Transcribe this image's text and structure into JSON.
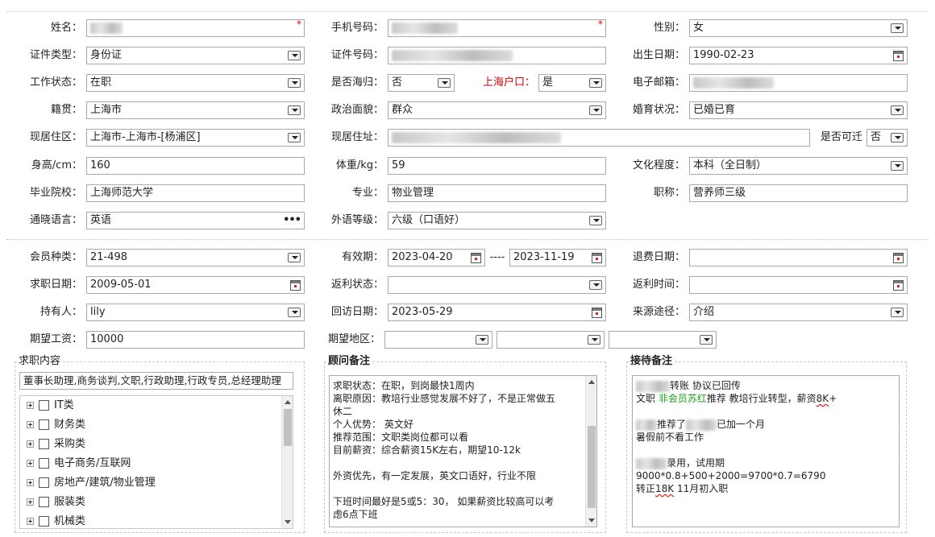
{
  "basic": {
    "name_label": "姓名：",
    "phone_label": "手机号码：",
    "gender_label": "性别：",
    "gender_value": "女",
    "idtype_label": "证件类型：",
    "idtype_value": "身份证",
    "idno_label": "证件号码：",
    "birth_label": "出生日期：",
    "birth_value": "1990-02-23",
    "workstatus_label": "工作状态：",
    "workstatus_value": "在职",
    "returnee_label": "是否海归：",
    "returnee_value": "否",
    "shhukou_label": "上海户口：",
    "shhukou_value": "是",
    "email_label": "电子邮箱：",
    "native_label": "籍贯：",
    "native_value": "上海市",
    "political_label": "政治面貌：",
    "political_value": "群众",
    "marital_label": "婚育状况：",
    "marital_value": "已婚已育",
    "residence_label": "现居住区：",
    "residence_value": "上海市-上海市-[杨浦区]",
    "address_label": "现居住址：",
    "relocate_label": "是否可迁",
    "relocate_value": "否",
    "height_label": "身高/cm：",
    "height_value": "160",
    "weight_label": "体重/kg：",
    "weight_value": "59",
    "education_label": "文化程度：",
    "education_value": "本科（全日制）",
    "school_label": "毕业院校：",
    "school_value": "上海师范大学",
    "major_label": "专业：",
    "major_value": "物业管理",
    "title_label": "职称：",
    "title_value": "营养师三级",
    "language_label": "通晓语言：",
    "language_value": "英语",
    "foreign_label": "外语等级：",
    "foreign_value": "六级（口语好）",
    "required_mark": "*",
    "more_dots": "•••"
  },
  "member": {
    "type_label": "会员种类：",
    "type_value": "21-498",
    "valid_label": "有效期：",
    "valid_from": "2023-04-20",
    "valid_sep": "----",
    "valid_to": "2023-11-19",
    "refund_label": "退费日期：",
    "jobdate_label": "求职日期：",
    "jobdate_value": "2009-05-01",
    "rebate_status_label": "返利状态：",
    "rebate_time_label": "返利时间：",
    "holder_label": "持有人：",
    "holder_value": "lily",
    "visit_label": "回访日期：",
    "visit_value": "2023-05-29",
    "source_label": "来源途径：",
    "source_value": "介绍",
    "salary_label": "期望工资：",
    "salary_value": "10000",
    "region_label": "期望地区："
  },
  "job_panel": {
    "title": "求职内容",
    "selected": "董事长助理,商务谈判,文职,行政助理,行政专员,总经理助理",
    "categories": [
      "IT类",
      "财务类",
      "采购类",
      "电子商务/互联网",
      "房地产/建筑/物业管理",
      "服装类",
      "机械类"
    ]
  },
  "advisor_panel": {
    "title": "顾问备注",
    "lines": [
      "求职状态：在职，到岗最快1周内",
      "离职原因：教培行业感觉发展不好了，不是正常做五",
      "休二",
      "个人优势：  英文好",
      "推荐范围：文职类岗位都可以看",
      "目前薪资：综合薪资15K左右，期望10-12k",
      "",
      "外资优先，有一定发展，英文口语好，行业不限",
      "",
      "下班时间最好是5或5：30，   如果薪资比较高可以考",
      "虑6点下班"
    ]
  },
  "reception_panel": {
    "title": "接待备注",
    "l1_after": "转账 协议已回传",
    "l2_a": "文职  ",
    "l2_green": "非会员苏红",
    "l2_b": "推荐 教培行业转型，薪资",
    "l2_u": "8K",
    "l2_c": "+",
    "l4_mid": "推荐了",
    "l4_after": "已加一个月",
    "l5": " 暑假前不看工作",
    "l7_after": "录用，试用期9000*0.8+500+2000=9700*0.7=6790",
    "l8_a": "转正",
    "l8_u": "18K",
    "l8_b": "    11月初入职"
  }
}
